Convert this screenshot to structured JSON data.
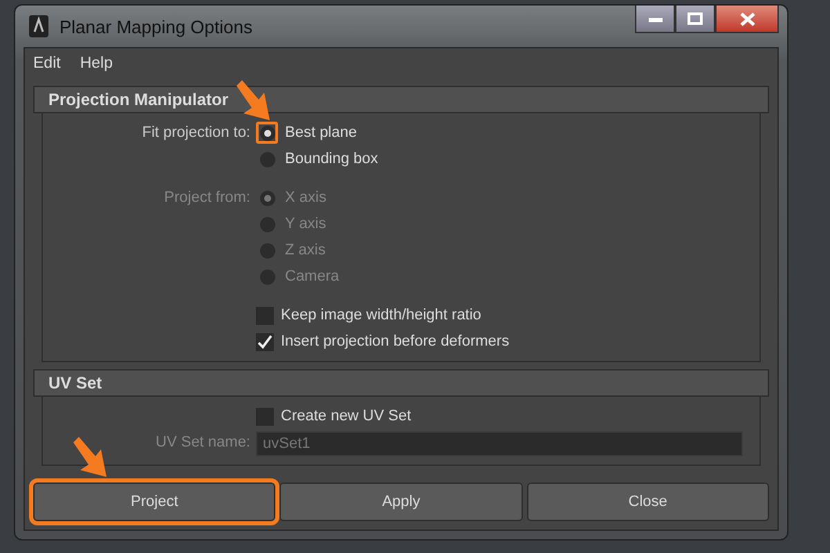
{
  "window": {
    "title": "Planar Mapping Options"
  },
  "menu": [
    "Edit",
    "Help"
  ],
  "sections": [
    {
      "title": "Projection Manipulator"
    },
    {
      "title": "UV Set"
    }
  ],
  "fit_projection": {
    "label": "Fit projection to:",
    "disabled": false,
    "options": [
      {
        "label": "Best plane",
        "selected": true,
        "highlighted": true
      },
      {
        "label": "Bounding box",
        "selected": false,
        "highlighted": false
      }
    ]
  },
  "project_from": {
    "label": "Project from:",
    "disabled": true,
    "options": [
      {
        "label": "X axis",
        "selected": true,
        "highlighted": false
      },
      {
        "label": "Y axis",
        "selected": false,
        "highlighted": false
      },
      {
        "label": "Z axis",
        "selected": false,
        "highlighted": false
      },
      {
        "label": "Camera",
        "selected": false,
        "highlighted": false
      }
    ]
  },
  "options": [
    {
      "label": "Keep image width/height ratio",
      "checked": false
    },
    {
      "label": "Insert projection before deformers",
      "checked": true
    }
  ],
  "uv_set": {
    "create": {
      "label": "Create new UV Set",
      "checked": false
    },
    "name": {
      "label": "UV Set name:",
      "value": "uvSet1",
      "disabled": true
    }
  },
  "buttons": [
    {
      "label": "Project",
      "highlighted": true
    },
    {
      "label": "Apply",
      "highlighted": false
    },
    {
      "label": "Close",
      "highlighted": false
    }
  ]
}
